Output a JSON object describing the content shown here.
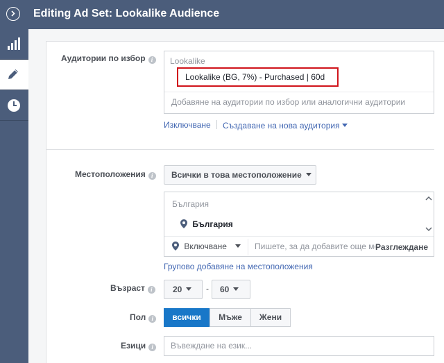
{
  "header": {
    "title": "Editing Ad Set: Lookalike Audience"
  },
  "sidebar": {
    "items": [
      {
        "icon": "bar-chart-icon"
      },
      {
        "icon": "pencil-icon"
      },
      {
        "icon": "clock-icon"
      }
    ]
  },
  "custom_audiences": {
    "label": "Аудитории по избор",
    "section_title": "Lookalike",
    "selected": "Lookalike (BG, 7%) - Purchased | 60d",
    "placeholder": "Добавяне на аудитории по избор или аналогични аудитории",
    "exclude_link": "Изключване",
    "create_link": "Създаване на нова аудитория"
  },
  "locations": {
    "label": "Местоположения",
    "dropdown": "Всички в това местоположение",
    "group_title": "България",
    "selected": "България",
    "include_dropdown": "Включване",
    "input_placeholder": "Пишете, за да добавите още ме",
    "browse": "Разглеждане",
    "bulk_link": "Групово добавяне на местоположения"
  },
  "age": {
    "label": "Възраст",
    "min": "20",
    "separator": "-",
    "max": "60"
  },
  "gender": {
    "label": "Пол",
    "options": [
      "всички",
      "Мъже",
      "Жени"
    ],
    "selected": "всички"
  },
  "languages": {
    "label": "Езици",
    "placeholder": "Въвеждане на език..."
  },
  "colors": {
    "header": "#4b5d7b",
    "accent": "#1877c8",
    "link": "#4267b2",
    "highlight": "#d0141b"
  }
}
